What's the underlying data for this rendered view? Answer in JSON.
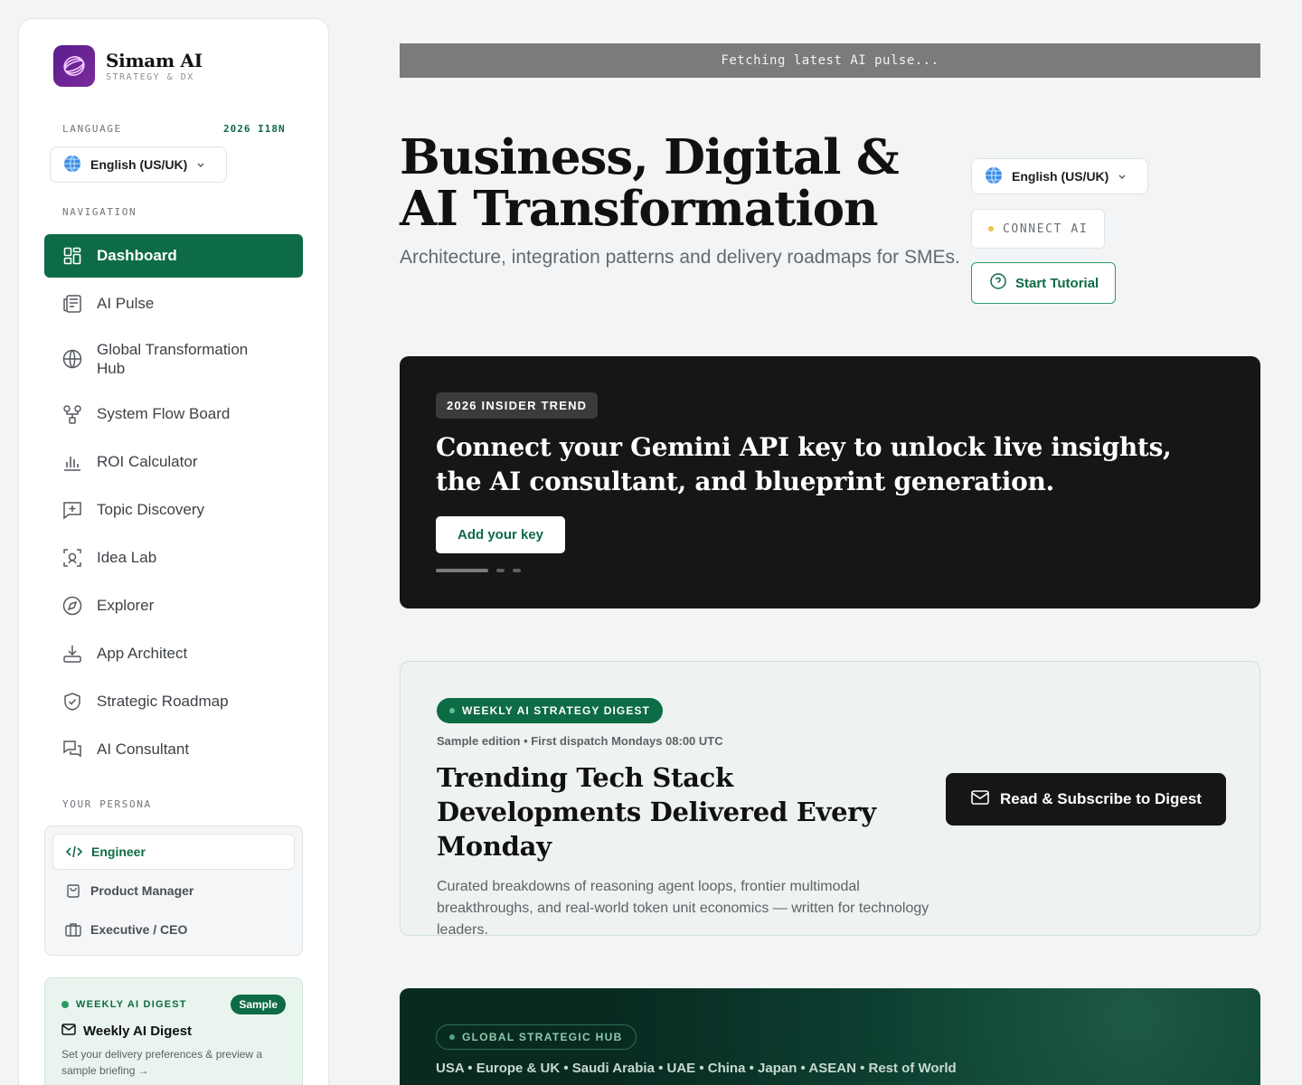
{
  "brand": {
    "name": "Simam AI",
    "tagline": "STRATEGY & DX"
  },
  "sidebar": {
    "language_label": "LANGUAGE",
    "i18n_badge": "2026 I18N",
    "language_value": "English (US/UK)",
    "navigation_label": "NAVIGATION",
    "nav_items": [
      {
        "label": "Dashboard",
        "icon": "dashboard-icon",
        "active": true
      },
      {
        "label": "AI Pulse",
        "icon": "newspaper-icon"
      },
      {
        "label": "Global Transformation Hub",
        "icon": "globe-icon"
      },
      {
        "label": "System Flow Board",
        "icon": "flow-icon"
      },
      {
        "label": "ROI Calculator",
        "icon": "bar-chart-icon"
      },
      {
        "label": "Topic Discovery",
        "icon": "message-plus-icon"
      },
      {
        "label": "Idea Lab",
        "icon": "idea-scan-icon"
      },
      {
        "label": "Explorer",
        "icon": "compass-icon"
      },
      {
        "label": "App Architect",
        "icon": "download-tray-icon"
      },
      {
        "label": "Strategic Roadmap",
        "icon": "shield-check-icon"
      },
      {
        "label": "AI Consultant",
        "icon": "chat-bubbles-icon"
      }
    ],
    "persona_label": "YOUR PERSONA",
    "personas": [
      {
        "label": "Engineer",
        "icon": "code-icon",
        "active": true
      },
      {
        "label": "Product Manager",
        "icon": "bag-icon"
      },
      {
        "label": "Executive / CEO",
        "icon": "briefcase-icon"
      }
    ],
    "digest": {
      "label": "WEEKLY AI DIGEST",
      "badge": "Sample",
      "title": "Weekly AI Digest",
      "description": "Set your delivery preferences & preview a sample briefing →"
    }
  },
  "ticker": "Fetching latest AI pulse...",
  "hero": {
    "title": "Business, Digital & AI Transformation",
    "subtitle": "Architecture, integration patterns and delivery roadmaps for SMEs.",
    "language_value": "English (US/UK)",
    "connect_label": "CONNECT AI",
    "tutorial_label": "Start Tutorial"
  },
  "trend": {
    "badge": "2026 INSIDER TREND",
    "title": "Connect your Gemini API key to unlock live insights, the AI consultant, and blueprint generation.",
    "button": "Add your key",
    "slides": 3,
    "active_slide": 1
  },
  "weekly": {
    "badge": "WEEKLY AI STRATEGY DIGEST",
    "meta": "Sample edition • First dispatch Mondays 08:00 UTC",
    "title": "Trending Tech Stack Developments Delivered Every Monday",
    "description": "Curated breakdowns of reasoning agent loops, frontier multimodal breakthroughs, and real-world token unit economics — written for technology leaders.",
    "button": "Read & Subscribe to Digest"
  },
  "global": {
    "badge": "GLOBAL STRATEGIC HUB",
    "regions": "USA • Europe & UK • Saudi Arabia • UAE • China • Japan • ASEAN • Rest of World"
  },
  "colors": {
    "accent": "#0d6b45",
    "dark": "#161616",
    "warning_dot": "#f1c24a"
  }
}
